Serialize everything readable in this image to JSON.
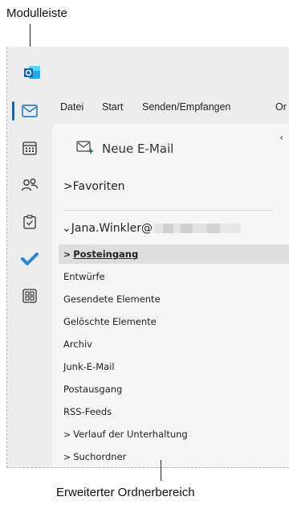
{
  "annotations": {
    "top": "Modulleiste",
    "bottom": "Erweiterter Ordnerbereich"
  },
  "ribbon": {
    "tabs": [
      "Datei",
      "Start",
      "Senden/Empfangen",
      "Or"
    ]
  },
  "folder_pane": {
    "new_mail": "Neue E-Mail",
    "favorites": "Favoriten",
    "account": "Jana.Winkler@",
    "folders": [
      {
        "label": "Posteingang",
        "chevron": ">"
      },
      {
        "label": "Entwürfe"
      },
      {
        "label": "Gesendete Elemente"
      },
      {
        "label": "Gelöschte Elemente"
      },
      {
        "label": "Archiv"
      },
      {
        "label": "Junk-E-Mail"
      },
      {
        "label": "Postausgang"
      },
      {
        "label": "RSS-Feeds"
      },
      {
        "label": "Verlauf der Unterhaltung",
        "chevron": ">"
      },
      {
        "label": "Suchordner",
        "chevron": ">"
      }
    ]
  },
  "module_bar": {
    "items": [
      "mail-icon",
      "calendar-icon",
      "people-icon",
      "tasks-icon",
      "todo-icon",
      "apps-icon"
    ]
  },
  "colors": {
    "accent": "#0f6cbd",
    "pane": "#f6f6f6",
    "frame": "#ededed",
    "selected": "#dedede",
    "todo": "#2b88d8"
  }
}
